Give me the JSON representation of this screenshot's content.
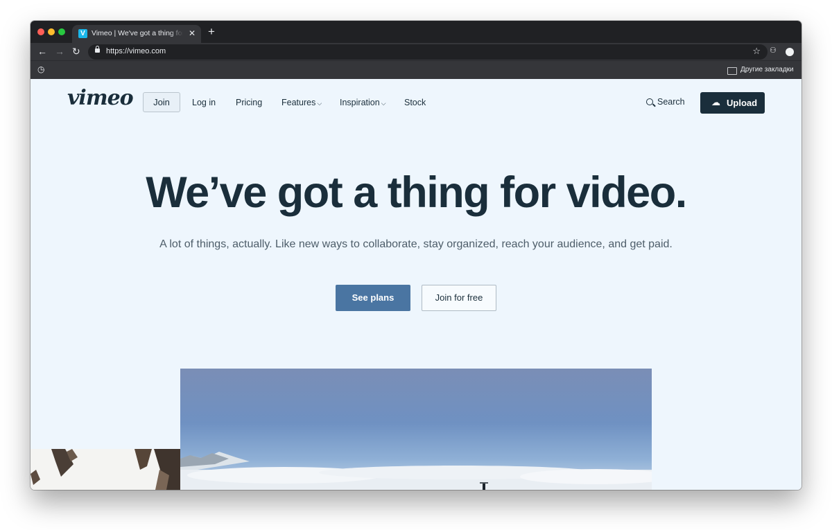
{
  "browser": {
    "tab_title": "Vimeo | We've got a thing for video",
    "tab_favicon": "V",
    "close_glyph": "✕",
    "new_tab_glyph": "+",
    "url": "https://vimeo.com",
    "bookmarks_folder": "Другие закладки"
  },
  "nav": {
    "logo": "vimeo",
    "join": "Join",
    "login": "Log in",
    "pricing": "Pricing",
    "features": "Features",
    "inspiration": "Inspiration",
    "stock": "Stock",
    "search": "Search",
    "upload": "Upload"
  },
  "hero": {
    "title": "We’ve got a thing for video.",
    "subtitle": "A lot of things, actually. Like new ways to collaborate, stay organized, reach your audience, and get paid.",
    "primary_button": "See plans",
    "secondary_button": "Join for free"
  },
  "colors": {
    "brand_dark": "#1a2e3b",
    "primary_button": "#4a75a2",
    "page_background": "#eef6fd"
  },
  "icons": [
    "back-arrow-icon",
    "forward-arrow-icon",
    "reload-icon",
    "lock-icon",
    "star-icon",
    "extension-icon",
    "profile-icon",
    "history-icon",
    "folder-icon",
    "search-icon",
    "cloud-upload-icon",
    "chevron-down-icon"
  ]
}
